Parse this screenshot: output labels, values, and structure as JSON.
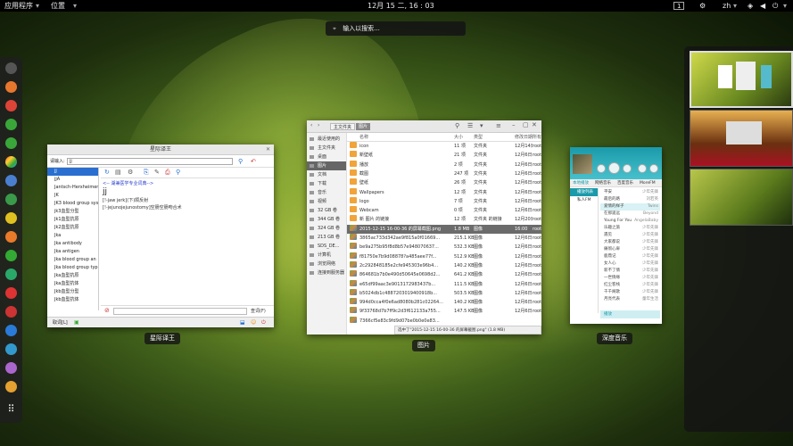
{
  "topbar": {
    "apps": "应用程序",
    "places": "位置",
    "clock": "12月 15 二, 16 : 03",
    "workspace": "1",
    "lang": "zh"
  },
  "search": {
    "placeholder": "输入以搜索..."
  },
  "dock_icons": [
    "terminal-icon",
    "firefox-icon",
    "chrome-icon",
    "app-green-icon",
    "app-colors-icon",
    "app-blue-icon",
    "app-green2-icon",
    "app-yellow-icon",
    "app-orange-icon",
    "app-green3-icon",
    "app-red-icon",
    "app-blue2-icon",
    "app-blue3-icon",
    "app-purple-icon",
    "app-mail-icon",
    "apps-grid-icon"
  ],
  "dict": {
    "title": "星际译王",
    "caption": "星际译王",
    "search_label": "请输入:",
    "search_value": "jj",
    "content_line1": "<-- 湖兼医学专业词典-->",
    "content_head": "jj",
    "content_line2": "[!-jaw jerk](下)颌反射",
    "content_line3": "[!-jejunojejunostomy]空肠空肠吻合术",
    "list": [
      "jj",
      "jjA",
      "Jantsch-Herxheimer",
      "JK",
      "JK3 blood group syst",
      "jk3血型分型",
      "Jk1血型抗原",
      "Jk2血型抗原",
      "Jka",
      "Jka antibody",
      "Jka antigen",
      "Jka blood group an",
      "Jka blood group typ",
      "Jka血型抗原",
      "Jka血型抗体",
      "Jkb血型分型",
      "Jkb血型抗体"
    ],
    "status_left": "取词[L]",
    "status_right": "查词(F)"
  },
  "files": {
    "caption": "图片",
    "path": [
      "主文件夹",
      "图片"
    ],
    "sidebar": [
      "最近使用的",
      "主文件夹",
      "桌面",
      "图片",
      "文档",
      "下载",
      "音乐",
      "视频",
      "32 GB 卷",
      "344 GB 卷",
      "324 GB 卷",
      "213 GB 卷",
      "SDS_DE...",
      "计算机",
      "浏览网络",
      "连接到服务器"
    ],
    "rows": [
      {
        "name": "icon",
        "size": "11 项",
        "type": "文件夹",
        "date": "12月14日",
        "owner": "root",
        "folder": true
      },
      {
        "name": "新壁纸",
        "size": "21 项",
        "type": "文件夹",
        "date": "12月6日",
        "owner": "root",
        "folder": true
      },
      {
        "name": "播放",
        "size": "2 项",
        "type": "文件夹",
        "date": "12月6日",
        "owner": "root",
        "folder": true
      },
      {
        "name": "截图",
        "size": "247 项",
        "type": "文件夹",
        "date": "12月6日",
        "owner": "root",
        "folder": true
      },
      {
        "name": "壁纸",
        "size": "26 项",
        "type": "文件夹",
        "date": "12月6日",
        "owner": "root",
        "folder": true
      },
      {
        "name": "Wallpapers",
        "size": "12 项",
        "type": "文件夹",
        "date": "12月6日",
        "owner": "root",
        "folder": true
      },
      {
        "name": "logo",
        "size": "7 项",
        "type": "文件夹",
        "date": "12月6日",
        "owner": "root",
        "folder": true
      },
      {
        "name": "Webcam",
        "size": "0 项",
        "type": "文件夹",
        "date": "12月6日",
        "owner": "root",
        "folder": true
      },
      {
        "name": "新 图片 的链接",
        "size": "12 项",
        "type": "文件夹 的链接",
        "date": "12月20日",
        "owner": "root",
        "folder": true
      },
      {
        "name": "2015-12-15 16-00-36 的屏幕截图.png",
        "size": "1.8 MB",
        "type": "图像",
        "date": "16:00",
        "owner": "root",
        "folder": false,
        "selected": true
      },
      {
        "name": "3865ac733d342ae9f815a0f01669...",
        "size": "215.1 KB",
        "type": "图像",
        "date": "12月6日",
        "owner": "root",
        "folder": false
      },
      {
        "name": "be9a275b95f8d8b57e948070637...",
        "size": "532.3 KB",
        "type": "图像",
        "date": "12月6日",
        "owner": "root",
        "folder": false
      },
      {
        "name": "f81750e7b9d08878?a485aee77f...",
        "size": "512.9 KB",
        "type": "图像",
        "date": "12月6日",
        "owner": "root",
        "folder": false
      },
      {
        "name": "2c292848185e2cfe945303e96b4...",
        "size": "140.2 KB",
        "type": "图像",
        "date": "12月6日",
        "owner": "root",
        "folder": false
      },
      {
        "name": "864681b7b0e490d50645e0698d2...",
        "size": "641.2 KB",
        "type": "图像",
        "date": "12月6日",
        "owner": "root",
        "folder": false
      },
      {
        "name": "e65df99aac3e9013172983437b...",
        "size": "111.5 KB",
        "type": "图像",
        "date": "12月6日",
        "owner": "root",
        "folder": false
      },
      {
        "name": "b5024db1c4887203019400918b...",
        "size": "503.5 KB",
        "type": "图像",
        "date": "12月6日",
        "owner": "root",
        "folder": false
      },
      {
        "name": "994d0cca4f0e6ad8080b281c02264...",
        "size": "140.2 KB",
        "type": "图像",
        "date": "12月6日",
        "owner": "root",
        "folder": false
      },
      {
        "name": "9f33768d7b7ff9c2d3f612133a755...",
        "size": "147.5 KB",
        "type": "图像",
        "date": "12月6日",
        "owner": "root",
        "folder": false
      },
      {
        "name": "7366cf5e83c9fd9d07be0b0e0e83...",
        "size": "",
        "type": "",
        "date": "",
        "owner": "",
        "folder": false
      }
    ],
    "headers": {
      "name": "名称",
      "size": "大小",
      "type": "类型",
      "date": "修改日期",
      "owner": "所有"
    },
    "status": "选中了\"2015-12-15 16-00-36 的屏幕截图.png\" (1.8 MB)"
  },
  "music": {
    "caption": "深度音乐",
    "tabs": [
      "本地播放",
      "网络音乐",
      "百度音乐",
      "MoreFM"
    ],
    "left": [
      "播放列表",
      "私人FM"
    ],
    "rows": [
      {
        "a": "平安",
        "b": "少年先锋"
      },
      {
        "a": "最后的路",
        "b": "刘若英"
      },
      {
        "a": "爱情的样子",
        "b": "Twins"
      },
      {
        "a": "在那遥远",
        "b": "Beyond"
      },
      {
        "a": "Young For You",
        "b": "AngelaBaby"
      },
      {
        "a": "乐趣之旅",
        "b": "少年先锋"
      },
      {
        "a": "遇见",
        "b": "少年先锋"
      },
      {
        "a": "大家都说",
        "b": "少年先锋"
      },
      {
        "a": "痛彻心扉",
        "b": "少年先锋"
      },
      {
        "a": "鹿鼎记",
        "b": "少年先锋"
      },
      {
        "a": "女人心",
        "b": "少年先锋"
      },
      {
        "a": "新不了情",
        "b": "少年先锋"
      },
      {
        "a": "一世情缘",
        "b": "少年先锋"
      },
      {
        "a": "红尘客栈",
        "b": "少年先锋"
      },
      {
        "a": "千千阕歌",
        "b": "少年先锋"
      },
      {
        "a": "月亮代表",
        "b": "童年生活"
      }
    ],
    "footer": "播放"
  }
}
